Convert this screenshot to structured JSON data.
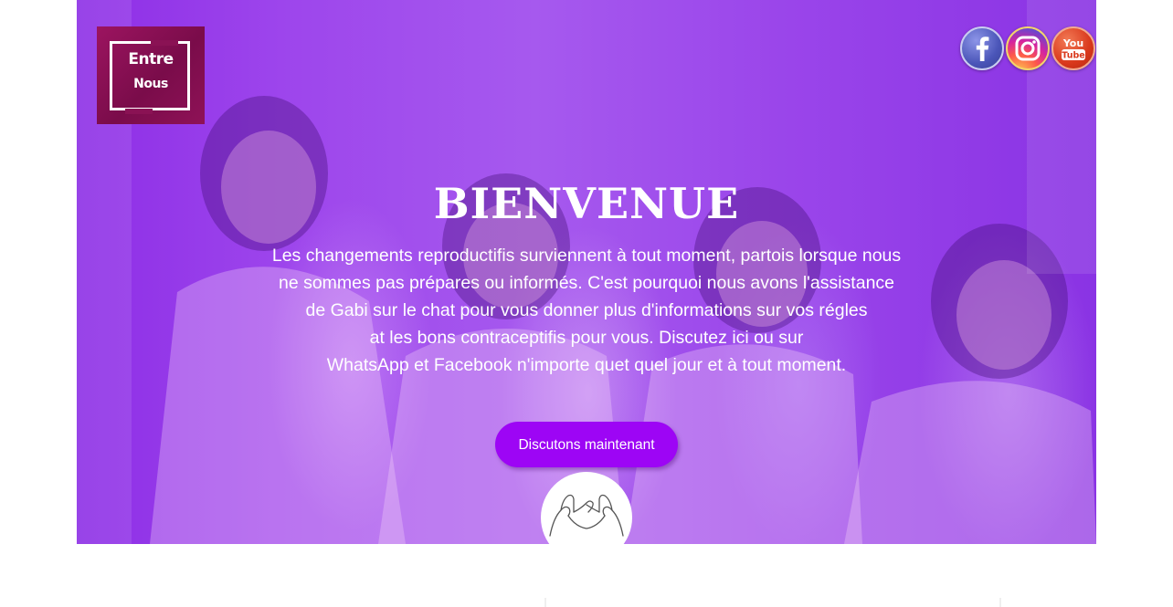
{
  "logo": {
    "line1": "Entre",
    "line2": "Nous"
  },
  "social": {
    "facebook": "facebook-icon",
    "instagram": "instagram-icon",
    "youtube": "youtube-icon",
    "youtube_text_1": "You",
    "youtube_text_2": "Tube"
  },
  "hero": {
    "title": "BIENVENUE",
    "lines": [
      "Les changements reproductifis surviennent à tout moment, partois lorsque nous",
      "ne sommes pas prépares ou informés. C'est pourquoi nous avons l'assistance",
      "de Gabi sur le chat pour vous donner plus d'informations sur vos régles",
      "at les bons contraceptifis pour vous. Discutez ici ou sur",
      "WhatsApp et Facebook n'importe quet quel jour et à tout moment."
    ],
    "cta_label": "Discutons maintenant"
  },
  "colors": {
    "overlay": "#9d45ec",
    "button": "#9d05f5"
  }
}
